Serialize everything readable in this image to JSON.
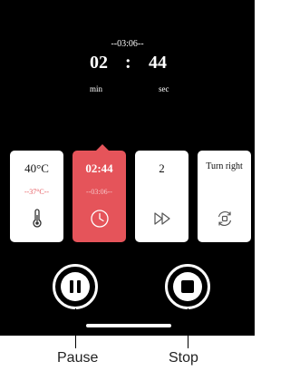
{
  "timer": {
    "total": "--03:06--",
    "minutes": "02",
    "separator": ":",
    "seconds": "44",
    "min_label": "min",
    "sec_label": "sec"
  },
  "cards": [
    {
      "main": "40°C",
      "sub": "--37°C--",
      "icon": "thermometer-icon"
    },
    {
      "main": "02:44",
      "sub": "--03:06--",
      "icon": "clock-icon",
      "active": true
    },
    {
      "main": "2",
      "sub": "",
      "icon": "fast-forward-icon"
    },
    {
      "main": "Turn right",
      "sub": "",
      "icon": "rotate-icon"
    }
  ],
  "controls": {
    "pause_icon": "pause-icon",
    "stop_icon": "stop-icon"
  },
  "callouts": {
    "pause": "Pause",
    "stop": "Stop"
  },
  "colors": {
    "screen": "#000000",
    "accent": "#e5545a",
    "card": "#ffffff"
  }
}
